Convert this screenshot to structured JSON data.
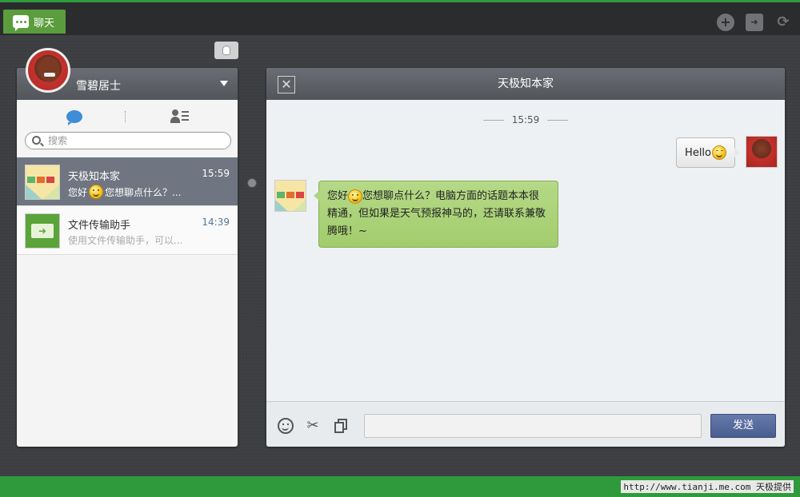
{
  "app": {
    "tab_label": "聊天"
  },
  "colors": {
    "accent_green": "#5b9d3c",
    "bottom_bar_green": "#2e9a3c",
    "active_row": "#6f7681",
    "send_button": "#4a5d8f",
    "bubble_in": "#a2cc6c"
  },
  "top_icons": [
    "plus-circle-icon",
    "folder-arrow-icon",
    "refresh-icon"
  ],
  "sidebar": {
    "user_name": "雪碧居士",
    "search_placeholder": "搜索",
    "conversations": [
      {
        "name": "天极知本家",
        "time": "15:59",
        "preview_before": "您好",
        "preview_after": "您想聊点什么？...",
        "active": true
      },
      {
        "name": "文件传输助手",
        "time": "14:39",
        "preview_before": "使用文件传输助手，可以...",
        "preview_after": "",
        "active": false
      }
    ]
  },
  "chat": {
    "title": "天极知本家",
    "timestamp": "15:59",
    "messages": [
      {
        "direction": "out",
        "text": "Hello"
      },
      {
        "direction": "in",
        "text_before": "您好",
        "text_after": "您想聊点什么？电脑方面的话题本本很精通，但如果是天气预报神马的，还请联系兼敬腾哦！~"
      }
    ],
    "send_label": "发送",
    "input_value": ""
  },
  "watermark": "http://www.tianji.me.com 天极提供"
}
